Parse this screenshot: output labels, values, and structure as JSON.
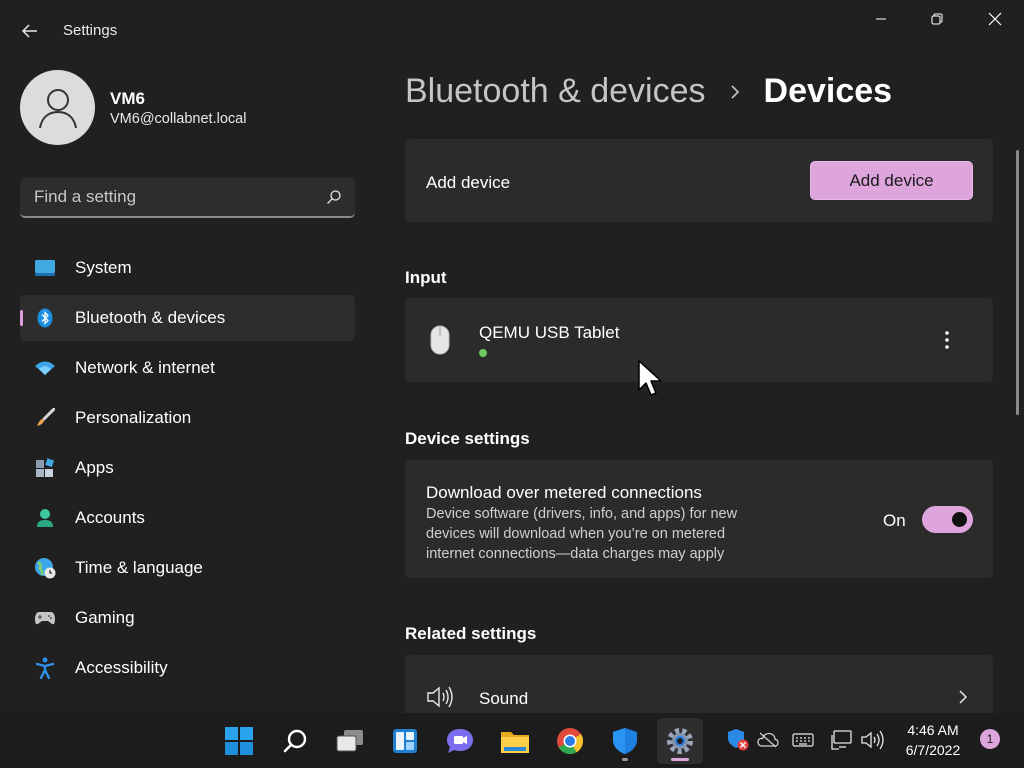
{
  "app": {
    "title": "Settings"
  },
  "profile": {
    "name": "VM6",
    "email": "VM6@collabnet.local"
  },
  "search": {
    "placeholder": "Find a setting"
  },
  "sidebar": {
    "items": [
      {
        "label": "System",
        "icon": "system-icon"
      },
      {
        "label": "Bluetooth & devices",
        "icon": "bluetooth-icon",
        "selected": true
      },
      {
        "label": "Network & internet",
        "icon": "wifi-icon"
      },
      {
        "label": "Personalization",
        "icon": "brush-icon"
      },
      {
        "label": "Apps",
        "icon": "apps-icon"
      },
      {
        "label": "Accounts",
        "icon": "accounts-icon"
      },
      {
        "label": "Time & language",
        "icon": "globe-clock-icon"
      },
      {
        "label": "Gaming",
        "icon": "gamepad-icon"
      },
      {
        "label": "Accessibility",
        "icon": "accessibility-icon"
      }
    ]
  },
  "breadcrumb": {
    "parent": "Bluetooth & devices",
    "current": "Devices"
  },
  "add_device": {
    "label": "Add device",
    "button": "Add device"
  },
  "input_section": {
    "title": "Input",
    "devices": [
      {
        "name": "QEMU USB Tablet",
        "status": "connected",
        "icon": "mouse-icon"
      }
    ]
  },
  "device_settings": {
    "title": "Device settings",
    "metered": {
      "title": "Download over metered connections",
      "line1": "Device software (drivers, info, and apps) for new",
      "line2": "devices will download when you’re on metered",
      "line3": "internet connections—data charges may apply",
      "toggle_label": "On",
      "enabled": true
    }
  },
  "related_settings": {
    "title": "Related settings",
    "sound": "Sound"
  },
  "taskbar": {
    "apps": [
      "start-icon",
      "search-icon",
      "task-view-icon",
      "widgets-icon",
      "teams-chat-icon",
      "file-explorer-icon",
      "chrome-icon",
      "defender-icon",
      "settings-icon"
    ],
    "tray": [
      "windows-security-icon",
      "onedrive-icon",
      "keyboard-icon",
      "network-icon",
      "volume-icon"
    ],
    "time": "4:46 AM",
    "date": "6/7/2022",
    "notifications": "1"
  },
  "colors": {
    "background": "#202020",
    "card": "#2b2b2b",
    "accent": "#dda5dc",
    "status_green": "#6ccb5f"
  }
}
